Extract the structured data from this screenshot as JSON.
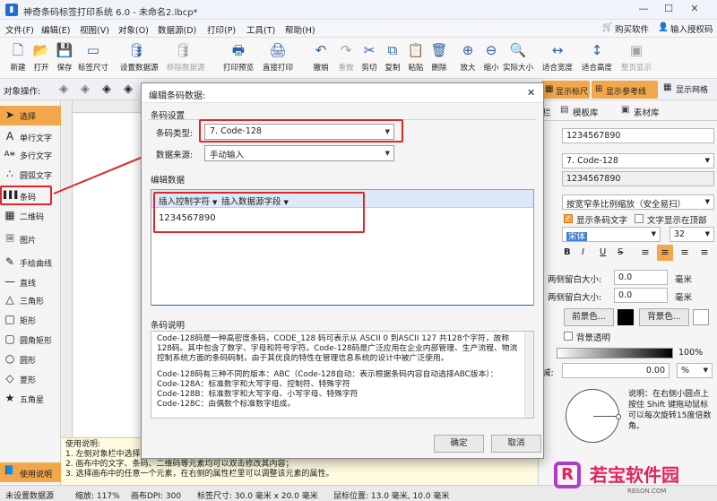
{
  "window": {
    "title": "神奇条码标签打印系统 6.0 - 未命名2.lbcp*",
    "minimize_glyph": "—",
    "maximize_glyph": "☐",
    "close_glyph": "✕"
  },
  "menubar": {
    "items": [
      "文件(F)",
      "编辑(E)",
      "视图(V)",
      "对象(O)",
      "数据源(D)",
      "打印(P)",
      "工具(T)",
      "帮助(H)"
    ],
    "buy_label": "购买软件",
    "authorize_label": "输入授权码"
  },
  "toolbar": {
    "buttons": [
      {
        "label": "新建",
        "icon": "new-file-icon",
        "glyph": "🗋"
      },
      {
        "label": "打开",
        "icon": "open-folder-icon",
        "glyph": "📂"
      },
      {
        "label": "保存",
        "icon": "save-icon",
        "glyph": "💾"
      },
      {
        "label": "标签尺寸",
        "icon": "label-size-icon",
        "glyph": "▭"
      },
      {
        "label": "设置数据源",
        "icon": "database-icon",
        "glyph": "🛢"
      },
      {
        "label": "移除数据源",
        "icon": "database-remove-icon",
        "glyph": "🛢",
        "disabled": true
      },
      {
        "label": "打印预览",
        "icon": "print-preview-icon",
        "glyph": "🖶"
      },
      {
        "label": "直接打印",
        "icon": "print-icon",
        "glyph": "🖨"
      },
      {
        "label": "撤销",
        "icon": "undo-icon",
        "glyph": "↶"
      },
      {
        "label": "重做",
        "icon": "redo-icon",
        "glyph": "↷",
        "disabled": true
      },
      {
        "label": "剪切",
        "icon": "cut-icon",
        "glyph": "✂"
      },
      {
        "label": "复制",
        "icon": "copy-icon",
        "glyph": "⧉"
      },
      {
        "label": "粘贴",
        "icon": "paste-icon",
        "glyph": "📋"
      },
      {
        "label": "删除",
        "icon": "delete-icon",
        "glyph": "🗑"
      },
      {
        "label": "放大",
        "icon": "zoom-in-icon",
        "glyph": "⊕"
      },
      {
        "label": "缩小",
        "icon": "zoom-out-icon",
        "glyph": "⊖"
      },
      {
        "label": "实际大小",
        "icon": "actual-size-icon",
        "glyph": "🔍"
      },
      {
        "label": "适合宽度",
        "icon": "fit-width-icon",
        "glyph": "↔"
      },
      {
        "label": "适合高度",
        "icon": "fit-height-icon",
        "glyph": "↕"
      },
      {
        "label": "整页显示",
        "icon": "fit-page-icon",
        "glyph": "▣",
        "disabled": true
      }
    ]
  },
  "opbar": {
    "label": "对象操作:",
    "show_ruler": "显示标尺",
    "show_guides": "显示参考线",
    "show_grid": "显示网格"
  },
  "left_tools": [
    {
      "label": "选择",
      "icon": "pointer-icon",
      "glyph": "➤"
    },
    {
      "label": "单行文字",
      "icon": "single-line-text-icon",
      "glyph": "A"
    },
    {
      "label": "多行文字",
      "icon": "multi-line-text-icon",
      "glyph": "A≡"
    },
    {
      "label": "圆弧文字",
      "icon": "arc-text-icon",
      "glyph": "∴"
    },
    {
      "label": "条码",
      "icon": "barcode-icon",
      "glyph": "▌▌▌"
    },
    {
      "label": "二维码",
      "icon": "qrcode-icon",
      "glyph": "▦"
    },
    {
      "label": "图片",
      "icon": "image-icon",
      "glyph": "🖼"
    },
    {
      "label": "手绘曲线",
      "icon": "freehand-icon",
      "glyph": "✎"
    },
    {
      "label": "直线",
      "icon": "line-icon",
      "glyph": "—"
    },
    {
      "label": "三角形",
      "icon": "triangle-icon",
      "glyph": "△"
    },
    {
      "label": "矩形",
      "icon": "rectangle-icon",
      "glyph": "□"
    },
    {
      "label": "圆角矩形",
      "icon": "rounded-rect-icon",
      "glyph": "▢"
    },
    {
      "label": "圆形",
      "icon": "circle-icon",
      "glyph": "○"
    },
    {
      "label": "菱形",
      "icon": "diamond-icon",
      "glyph": "◇"
    },
    {
      "label": "五角星",
      "icon": "star-icon",
      "glyph": "★"
    }
  ],
  "help": {
    "button": "使用说明",
    "title": "使用说明:",
    "lines": [
      "1. 左侧对象栏中选择要绘制的元素，在标签中单击或拖动绘制元素",
      "2. 画布中的文字、条码、二维码等元素均可以双击修改其内容；",
      "3. 选择画布中的任意一个元素，在右侧的属性栏里可以调整该元素的属性。"
    ]
  },
  "dialog": {
    "title": "编辑条码数据:",
    "settings_group": "条码设置",
    "type_label": "条码类型:",
    "type_value": "7.  Code-128",
    "source_label": "数据来源:",
    "source_value": "手动输入",
    "edit_group": "编辑数据",
    "insert_ctrl": "插入控制字符",
    "insert_field": "插入数据源字段",
    "data_value": "1234567890",
    "desc_group": "条码说明",
    "desc_p1": "Code-128码是一种高密度条码，CODE_128 码可表示从 ASCII 0 到ASCII 127 共128个字符，故称128码。其中包含了数字、字母和符号字符。Code-128码是广泛应用在企业内部管理、生产流程、物流控制系统方面的条码码制，由于其优良的特性在管理信息系统的设计中被广泛使用。",
    "desc_p2": "Code-128码有三种不同的版本：ABC（Code-128自动：表示根据条码内容自动选择ABC版本）：",
    "desc_a": "Code-128A：标准数字和大写字母、控制符、特殊字符",
    "desc_b": "Code-128B：标准数字和大写字母、小写字母、特殊字符",
    "desc_c": "Code-128C：由偶数个标准数字组成。",
    "ok": "确定",
    "cancel": "取消"
  },
  "right_panel": {
    "tab_partial": "栏",
    "tab_template": "模板库",
    "tab_material": "素材库",
    "content_value": "1234567890",
    "type_value": "7.  Code-128",
    "data_value": "1234567890",
    "scale_value": "按宽窄条比例缩放（安全易扫）",
    "show_text_label": "显示条码文字",
    "show_top_label": "文字显示在顶部",
    "font_value": "宋体",
    "font_size": "32",
    "bold": "B",
    "italic": "I",
    "underline": "U",
    "strike": "S",
    "margin_lr_label": "两侧留白大小:",
    "margin_lr_value": "0.0",
    "margin_tb_label": "两侧留白大小:",
    "margin_tb_value": "0.0",
    "unit_mm": "毫米",
    "fg_label": "前景色...",
    "bg_label": "背景色...",
    "transparent_label": "背景透明",
    "opacity_value": "100%",
    "rotate_value": "0.00",
    "rotate_unit": "%",
    "rotate_label_partial": "减:",
    "note": "说明：在右侧小圆点上按住 Shift 键拖动鼠标可以每次旋转15度倍数角。",
    "colors": {
      "foreground": "#000000",
      "background": "#ffffff"
    }
  },
  "statusbar": {
    "status": "未设置数据源",
    "zoom": "缩放: 117%",
    "dpi": "画布DPI: 300",
    "size": "标签尺寸: 30.0 毫米 x 20.0 毫米",
    "mouse": "鼠标位置: 13.0 毫米, 10.0 毫米"
  },
  "watermark": {
    "text": "若宝软件园",
    "sub": "RBSON.COM"
  }
}
